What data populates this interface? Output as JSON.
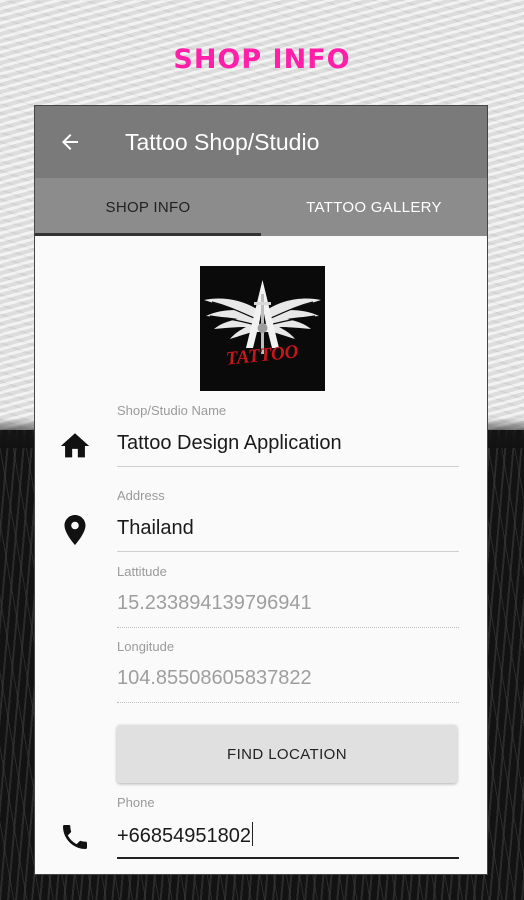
{
  "headline": {
    "text": "SHOP INFO",
    "color": "#ff1fa8"
  },
  "theme": {
    "appbar_color": "#7a7a7a",
    "tabbar_color": "#8c8c8c",
    "active_tab_text": "#222222",
    "inactive_tab_text": "#ffffff"
  },
  "appbar": {
    "back_icon": "arrow-left-icon",
    "title": "Tattoo Shop/Studio"
  },
  "tabs": [
    {
      "label": "SHOP INFO",
      "active": true
    },
    {
      "label": "TATTOO GALLERY",
      "active": false
    }
  ],
  "logo": {
    "icon": "tattoo-winged-logo",
    "text": "TATTOO"
  },
  "form": {
    "shop_name": {
      "label": "Shop/Studio Name",
      "value": "Tattoo Design Application",
      "icon": "home-icon"
    },
    "address": {
      "label": "Address",
      "value": "Thailand",
      "icon": "location-pin-icon"
    },
    "latitude": {
      "label": "Lattitude",
      "value": "15.233894139796941"
    },
    "longitude": {
      "label": "Longitude",
      "value": "104.85508605837822"
    },
    "find_location_label": "FIND LOCATION",
    "phone": {
      "label": "Phone",
      "value": "+66854951802",
      "icon": "phone-icon"
    }
  }
}
